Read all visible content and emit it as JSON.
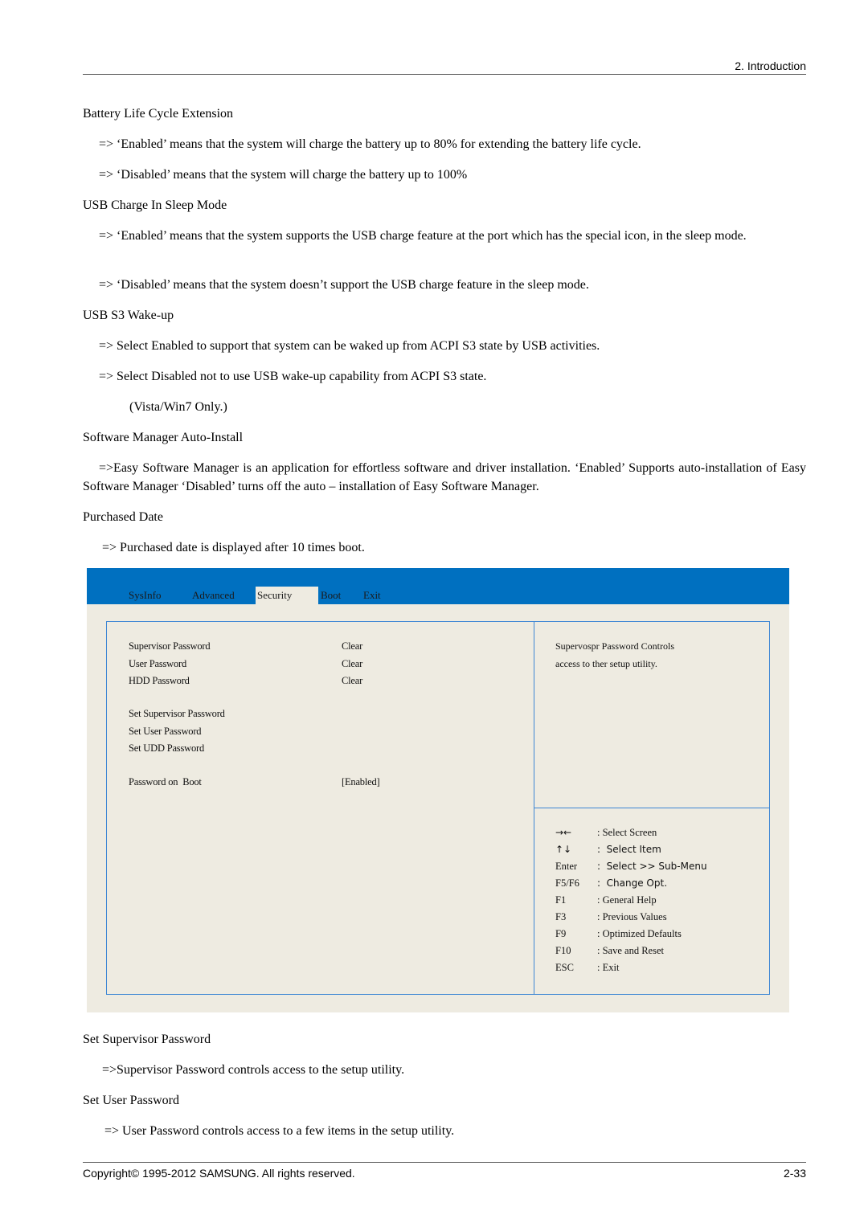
{
  "header": {
    "section": "2.  Introduction"
  },
  "sections": {
    "battery": {
      "title": "Battery Life Cycle Extension",
      "line1": "=> ‘Enabled’ means that the system will charge the battery up to 80% for extending the battery life cycle.",
      "line2": "=> ‘Disabled’ means that the system will charge the battery up to 100%"
    },
    "usb_charge": {
      "title": "USB Charge In Sleep Mode",
      "line1": "=> ‘Enabled’ means that the system supports the USB charge feature at the port which has the special icon, in the sleep mode.",
      "line2": "=> ‘Disabled’ means that the system doesn’t support the USB charge feature in the sleep mode."
    },
    "usb_s3": {
      "title": "USB S3 Wake-up",
      "line1": "=> Select Enabled to support that system can be waked up from ACPI S3 state by USB activities.",
      "line2": "=> Select Disabled not to use USB wake-up capability from ACPI S3 state.",
      "line3": "(Vista/Win7 Only.)"
    },
    "software_manager": {
      "title": "Software Manager Auto-Install",
      "line1": "=>Easy Software Manager is an application for effortless software and driver installation.  ‘Enabled’ Supports auto-installation of Easy Software Manager ‘Disabled’ turns off the auto – installation of Easy Software Manager."
    },
    "purchased_date": {
      "title": "Purchased Date",
      "line1": "=> Purchased date is displayed after 10 times boot."
    },
    "set_supervisor": {
      "title": "Set Supervisor Password",
      "line1": "=>Supervisor Password controls access to the setup utility."
    },
    "set_user": {
      "title": "Set User Password",
      "line1": "=> User Password controls access to a few items in the setup utility."
    }
  },
  "bios": {
    "colors": {
      "bar": "#0070c0",
      "background": "#eeebe1",
      "border": "#3d86d4"
    },
    "tabs": [
      {
        "label": "SysInfo",
        "active": false
      },
      {
        "label": "Advanced",
        "active": false
      },
      {
        "label": "Security",
        "active": true
      },
      {
        "label": "Boot",
        "active": false
      },
      {
        "label": "Exit",
        "active": false
      }
    ],
    "items": [
      {
        "label": "Supervisor Password",
        "value": "Clear"
      },
      {
        "label": "User Password",
        "value": "Clear"
      },
      {
        "label": "HDD Password",
        "value": "Clear"
      },
      {
        "label": "Set Supervisor Password",
        "value": ""
      },
      {
        "label": "Set User Password",
        "value": ""
      },
      {
        "label": "Set UDD Password",
        "value": ""
      },
      {
        "label": "Password on  Boot",
        "value": "[Enabled]"
      }
    ],
    "help_text": {
      "line1": "Supervospr Password Controls",
      "line2": "access to ther setup utility."
    },
    "keys": [
      {
        "key": "→←",
        "desc": ": Select Screen"
      },
      {
        "key": "↑↓",
        "desc": ":  Select Item"
      },
      {
        "key": "Enter",
        "desc": ":  Select >> Sub-Menu"
      },
      {
        "key": "F5/F6",
        "desc": ":  Change Opt."
      },
      {
        "key": "F1",
        "desc": ": General Help"
      },
      {
        "key": "F3",
        "desc": ": Previous Values"
      },
      {
        "key": "F9",
        "desc": ": Optimized Defaults"
      },
      {
        "key": "F10",
        "desc": ": Save and Reset"
      },
      {
        "key": "ESC",
        "desc": ": Exit"
      }
    ]
  },
  "footer": {
    "copyright": "Copyright© 1995-2012 SAMSUNG. All rights reserved.",
    "page": "2-33"
  }
}
